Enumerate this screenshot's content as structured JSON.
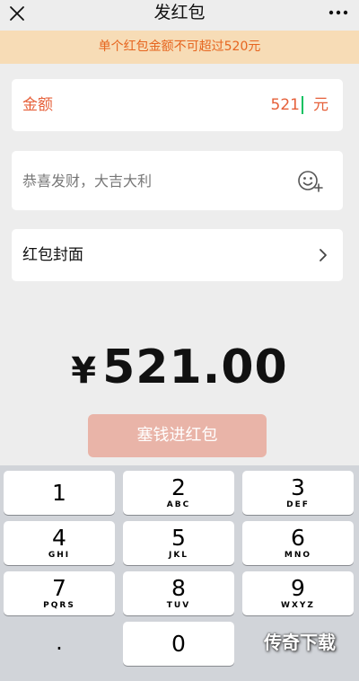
{
  "header": {
    "title": "发红包"
  },
  "banner": {
    "text": "单个红包金额不可超过520元"
  },
  "amount": {
    "label": "金额",
    "value": "521",
    "unit": "元"
  },
  "message": {
    "placeholder": "恭喜发财，大吉大利"
  },
  "cover": {
    "label": "红包封面"
  },
  "total": {
    "symbol": "¥",
    "value": "521.00"
  },
  "submit": {
    "label": "塞钱进红包"
  },
  "keypad": {
    "keys": [
      {
        "num": "1",
        "letters": ""
      },
      {
        "num": "2",
        "letters": "ABC"
      },
      {
        "num": "3",
        "letters": "DEF"
      },
      {
        "num": "4",
        "letters": "GHI"
      },
      {
        "num": "5",
        "letters": "JKL"
      },
      {
        "num": "6",
        "letters": "MNO"
      },
      {
        "num": "7",
        "letters": "PQRS"
      },
      {
        "num": "8",
        "letters": "TUV"
      },
      {
        "num": "9",
        "letters": "WXYZ"
      },
      {
        "num": "."
      },
      {
        "num": "0"
      }
    ]
  },
  "watermark": {
    "text": "传奇下载"
  },
  "colors": {
    "accent": "#e6603a",
    "banner_bg": "#f7dcb6",
    "banner_text": "#e6651f",
    "submit_bg": "#e9b4a8",
    "cursor": "#07c160"
  },
  "icons": [
    "close-icon",
    "more-icon",
    "emoji-icon",
    "chevron-right-icon"
  ]
}
